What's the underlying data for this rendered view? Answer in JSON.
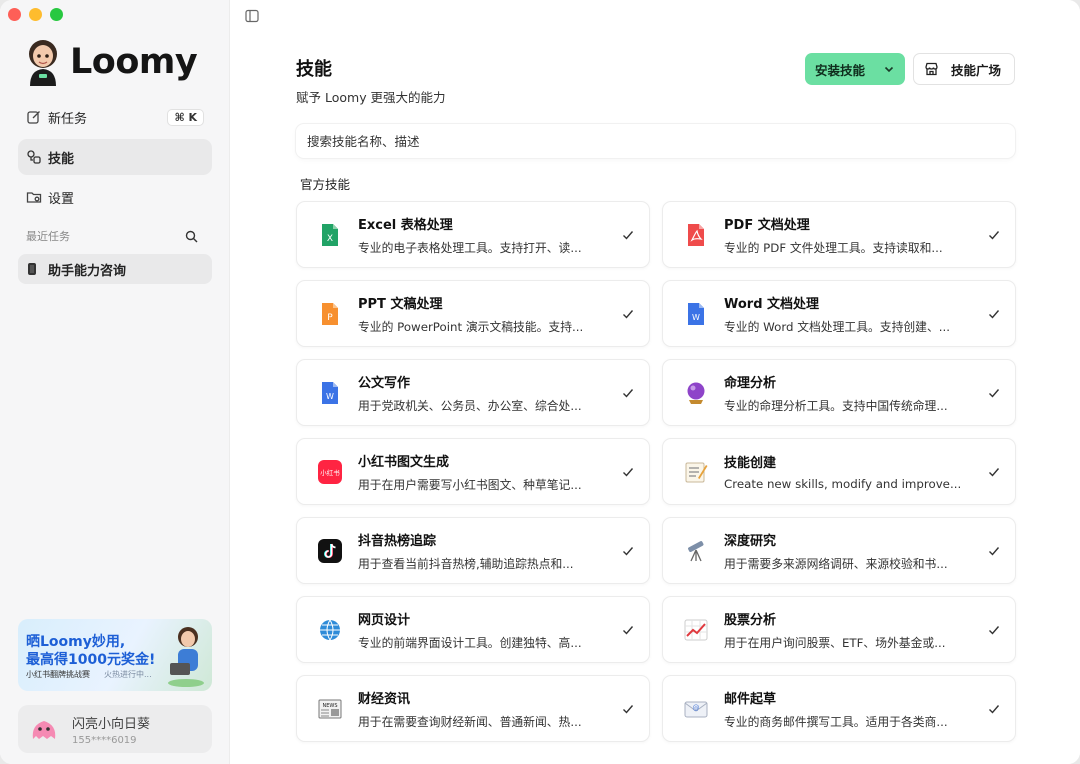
{
  "app": {
    "name": "Loomy"
  },
  "sidebar": {
    "nav": [
      {
        "label": "新任务",
        "icon": "edit-icon",
        "shortcut": "⌘ K"
      },
      {
        "label": "技能",
        "icon": "skills-icon",
        "active": true
      },
      {
        "label": "设置",
        "icon": "folder-settings-icon"
      }
    ],
    "recent_label": "最近任务",
    "recent_items": [
      {
        "label": "助手能力咨询",
        "icon": "phone-icon"
      }
    ],
    "banner": {
      "line1": "晒Loomy妙用,",
      "line2": "最高得1000元奖金!",
      "line3": "小红书翻牌挑战赛",
      "line4": "火热进行中..."
    },
    "user": {
      "name": "闪亮小向日葵",
      "phone": "155****6019"
    }
  },
  "main": {
    "title": "技能",
    "subtitle": "赋予 Loomy 更强大的能力",
    "install_button": "安装技能",
    "market_button": "技能广场",
    "search_placeholder": "搜索技能名称、描述",
    "section_title": "官方技能",
    "skills": [
      {
        "name": "Excel 表格处理",
        "desc": "专业的电子表格处理工具。支持打开、读...",
        "icon": "excel-icon"
      },
      {
        "name": "PDF 文档处理",
        "desc": "专业的 PDF 文件处理工具。支持读取和...",
        "icon": "pdf-icon"
      },
      {
        "name": "PPT 文稿处理",
        "desc": "专业的 PowerPoint 演示文稿技能。支持...",
        "icon": "ppt-icon"
      },
      {
        "name": "Word 文档处理",
        "desc": "专业的 Word 文档处理工具。支持创建、...",
        "icon": "word-icon"
      },
      {
        "name": "公文写作",
        "desc": "用于党政机关、公务员、办公室、综合处...",
        "icon": "word-icon"
      },
      {
        "name": "命理分析",
        "desc": "专业的命理分析工具。支持中国传统命理...",
        "icon": "crystal-ball-icon"
      },
      {
        "name": "小红书图文生成",
        "desc": "用于在用户需要写小红书图文、种草笔记...",
        "icon": "xiaohongshu-icon"
      },
      {
        "name": "技能创建",
        "desc": "Create new skills, modify and improve...",
        "icon": "memo-icon"
      },
      {
        "name": "抖音热榜追踪",
        "desc": "用于查看当前抖音热榜,辅助追踪热点和...",
        "icon": "tiktok-icon"
      },
      {
        "name": "深度研究",
        "desc": "用于需要多来源网络调研、来源校验和书...",
        "icon": "telescope-icon"
      },
      {
        "name": "网页设计",
        "desc": "专业的前端界面设计工具。创建独特、高...",
        "icon": "globe-icon"
      },
      {
        "name": "股票分析",
        "desc": "用于在用户询问股票、ETF、场外基金或...",
        "icon": "chart-up-icon"
      },
      {
        "name": "财经资讯",
        "desc": "用于在需要查询财经新闻、普通新闻、热...",
        "icon": "newspaper-icon"
      },
      {
        "name": "邮件起草",
        "desc": "专业的商务邮件撰写工具。适用于各类商...",
        "icon": "email-icon"
      }
    ]
  },
  "colors": {
    "accent": "#6bdfa2",
    "sidebar_bg": "#f6f6f7"
  }
}
